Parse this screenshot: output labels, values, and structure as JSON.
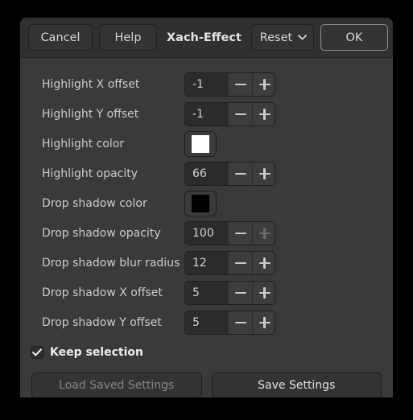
{
  "window": {
    "title": "Xach-Effect"
  },
  "header": {
    "cancel_label": "Cancel",
    "help_label": "Help",
    "title": "Xach-Effect",
    "reset_label": "Reset",
    "reset_icon": "chevron-down-icon",
    "ok_label": "OK"
  },
  "settings": [
    {
      "label": "Highlight X offset",
      "control": "spin",
      "value": "-1",
      "minus_enabled": true,
      "plus_enabled": true
    },
    {
      "label": "Highlight Y offset",
      "control": "spin",
      "value": "-1",
      "minus_enabled": true,
      "plus_enabled": true
    },
    {
      "label": "Highlight color",
      "control": "color",
      "value": "#ffffff"
    },
    {
      "label": "Highlight opacity",
      "control": "spin",
      "value": "66",
      "minus_enabled": true,
      "plus_enabled": true
    },
    {
      "label": "Drop shadow color",
      "control": "color",
      "value": "#000000"
    },
    {
      "label": "Drop shadow opacity",
      "control": "spin",
      "value": "100",
      "minus_enabled": true,
      "plus_enabled": false
    },
    {
      "label": "Drop shadow blur radius",
      "control": "spin",
      "value": "12",
      "minus_enabled": true,
      "plus_enabled": true
    },
    {
      "label": "Drop shadow X offset",
      "control": "spin",
      "value": "5",
      "minus_enabled": true,
      "plus_enabled": true
    },
    {
      "label": "Drop shadow Y offset",
      "control": "spin",
      "value": "5",
      "minus_enabled": true,
      "plus_enabled": true
    }
  ],
  "keep_selection": {
    "label": "Keep selection",
    "checked": true,
    "icon": "checkmark-icon"
  },
  "bottom_actions": {
    "load_label": "Load Saved Settings",
    "load_enabled": false,
    "save_label": "Save Settings",
    "save_enabled": true
  },
  "colors": {
    "window_bg": "#3a3a3a",
    "header_bg": "#303030",
    "button_bg": "#333333",
    "entry_bg": "#2b2b2b",
    "text": "#cccccc",
    "text_bright": "#ededed",
    "text_disabled": "#868686",
    "border": "#1f1f1f",
    "focus_border": "#8e8e8e",
    "desktop_bg": "#000000"
  }
}
